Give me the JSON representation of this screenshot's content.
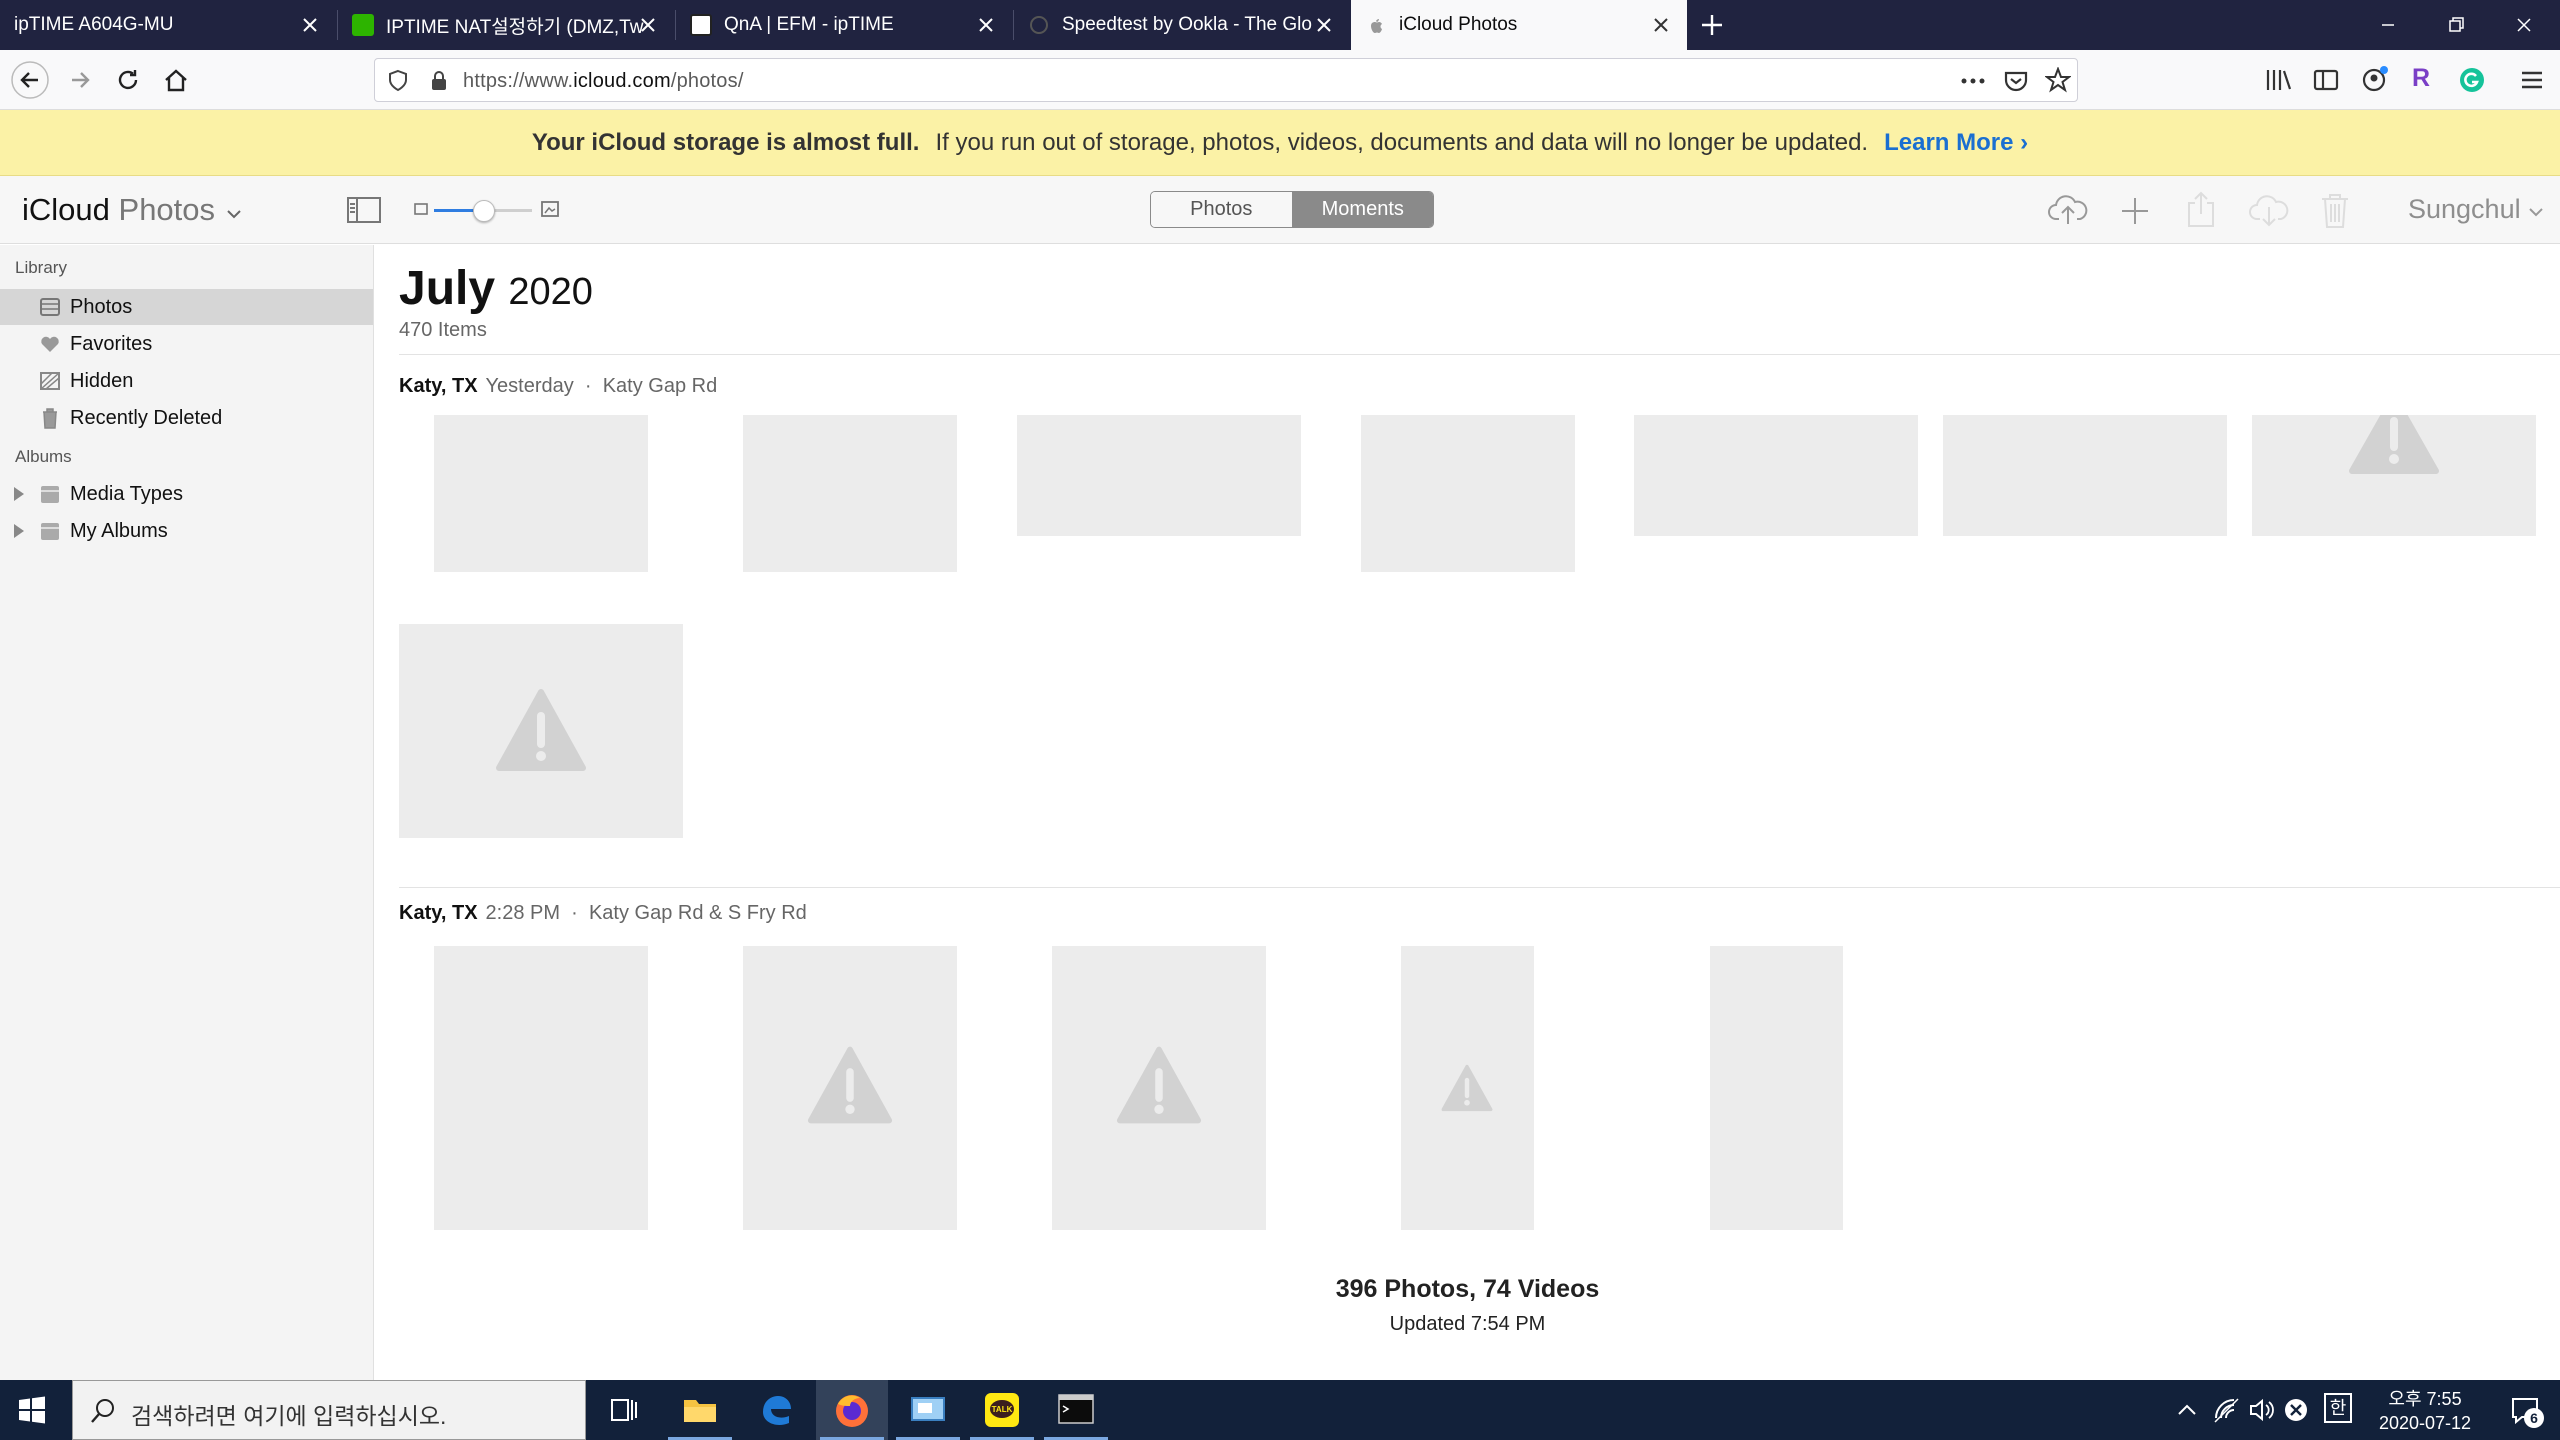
{
  "browser": {
    "tabs": [
      {
        "title": "ipTIME A604G-MU",
        "favicon": "none"
      },
      {
        "title": "IPTIME NAT설정하기 (DMZ,Tw",
        "favicon": "naver-green"
      },
      {
        "title": "QnA | EFM - ipTIME",
        "favicon": "iptime-logo"
      },
      {
        "title": "Speedtest by Ookla - The Glo",
        "favicon": "speedtest"
      },
      {
        "title": "iCloud Photos",
        "favicon": "apple-logo"
      }
    ],
    "active_tab": 4,
    "url_prefix": "https://www.",
    "url_host": "icloud.com",
    "url_path": "/photos/"
  },
  "banner": {
    "bold": "Your iCloud storage is almost full.",
    "text": "If you run out of storage, photos, videos, documents and data will no longer be updated.",
    "link": "Learn More",
    "link_chevron": "›"
  },
  "app": {
    "logo_main": "iCloud",
    "logo_sub": "Photos",
    "segment": {
      "left": "Photos",
      "right": "Moments",
      "selected": "Moments"
    },
    "user": "Sungchul"
  },
  "sidebar": {
    "library_heading": "Library",
    "library_items": [
      {
        "label": "Photos",
        "icon": "photos-icon",
        "selected": true
      },
      {
        "label": "Favorites",
        "icon": "heart-icon"
      },
      {
        "label": "Hidden",
        "icon": "hidden-icon"
      },
      {
        "label": "Recently Deleted",
        "icon": "trash-icon"
      }
    ],
    "albums_heading": "Albums",
    "album_items": [
      {
        "label": "Media Types",
        "icon": "album-icon"
      },
      {
        "label": "My Albums",
        "icon": "album-icon"
      }
    ]
  },
  "main": {
    "month": "July",
    "year": "2020",
    "count": "470 Items",
    "moments": [
      {
        "place": "Katy, TX",
        "time": "Yesterday",
        "sep": "·",
        "location": "Katy Gap Rd"
      },
      {
        "place": "Katy, TX",
        "time": "2:28 PM",
        "sep": "·",
        "location": "Katy Gap Rd & S Fry Rd"
      }
    ],
    "footer_summary": "396 Photos, 74 Videos",
    "footer_updated": "Updated 7:54 PM"
  },
  "taskbar": {
    "search_placeholder": "검색하려면 여기에 입력하십시오.",
    "time": "오후 7:55",
    "date": "2020-07-12",
    "ime": "한",
    "notif_count": "6"
  }
}
